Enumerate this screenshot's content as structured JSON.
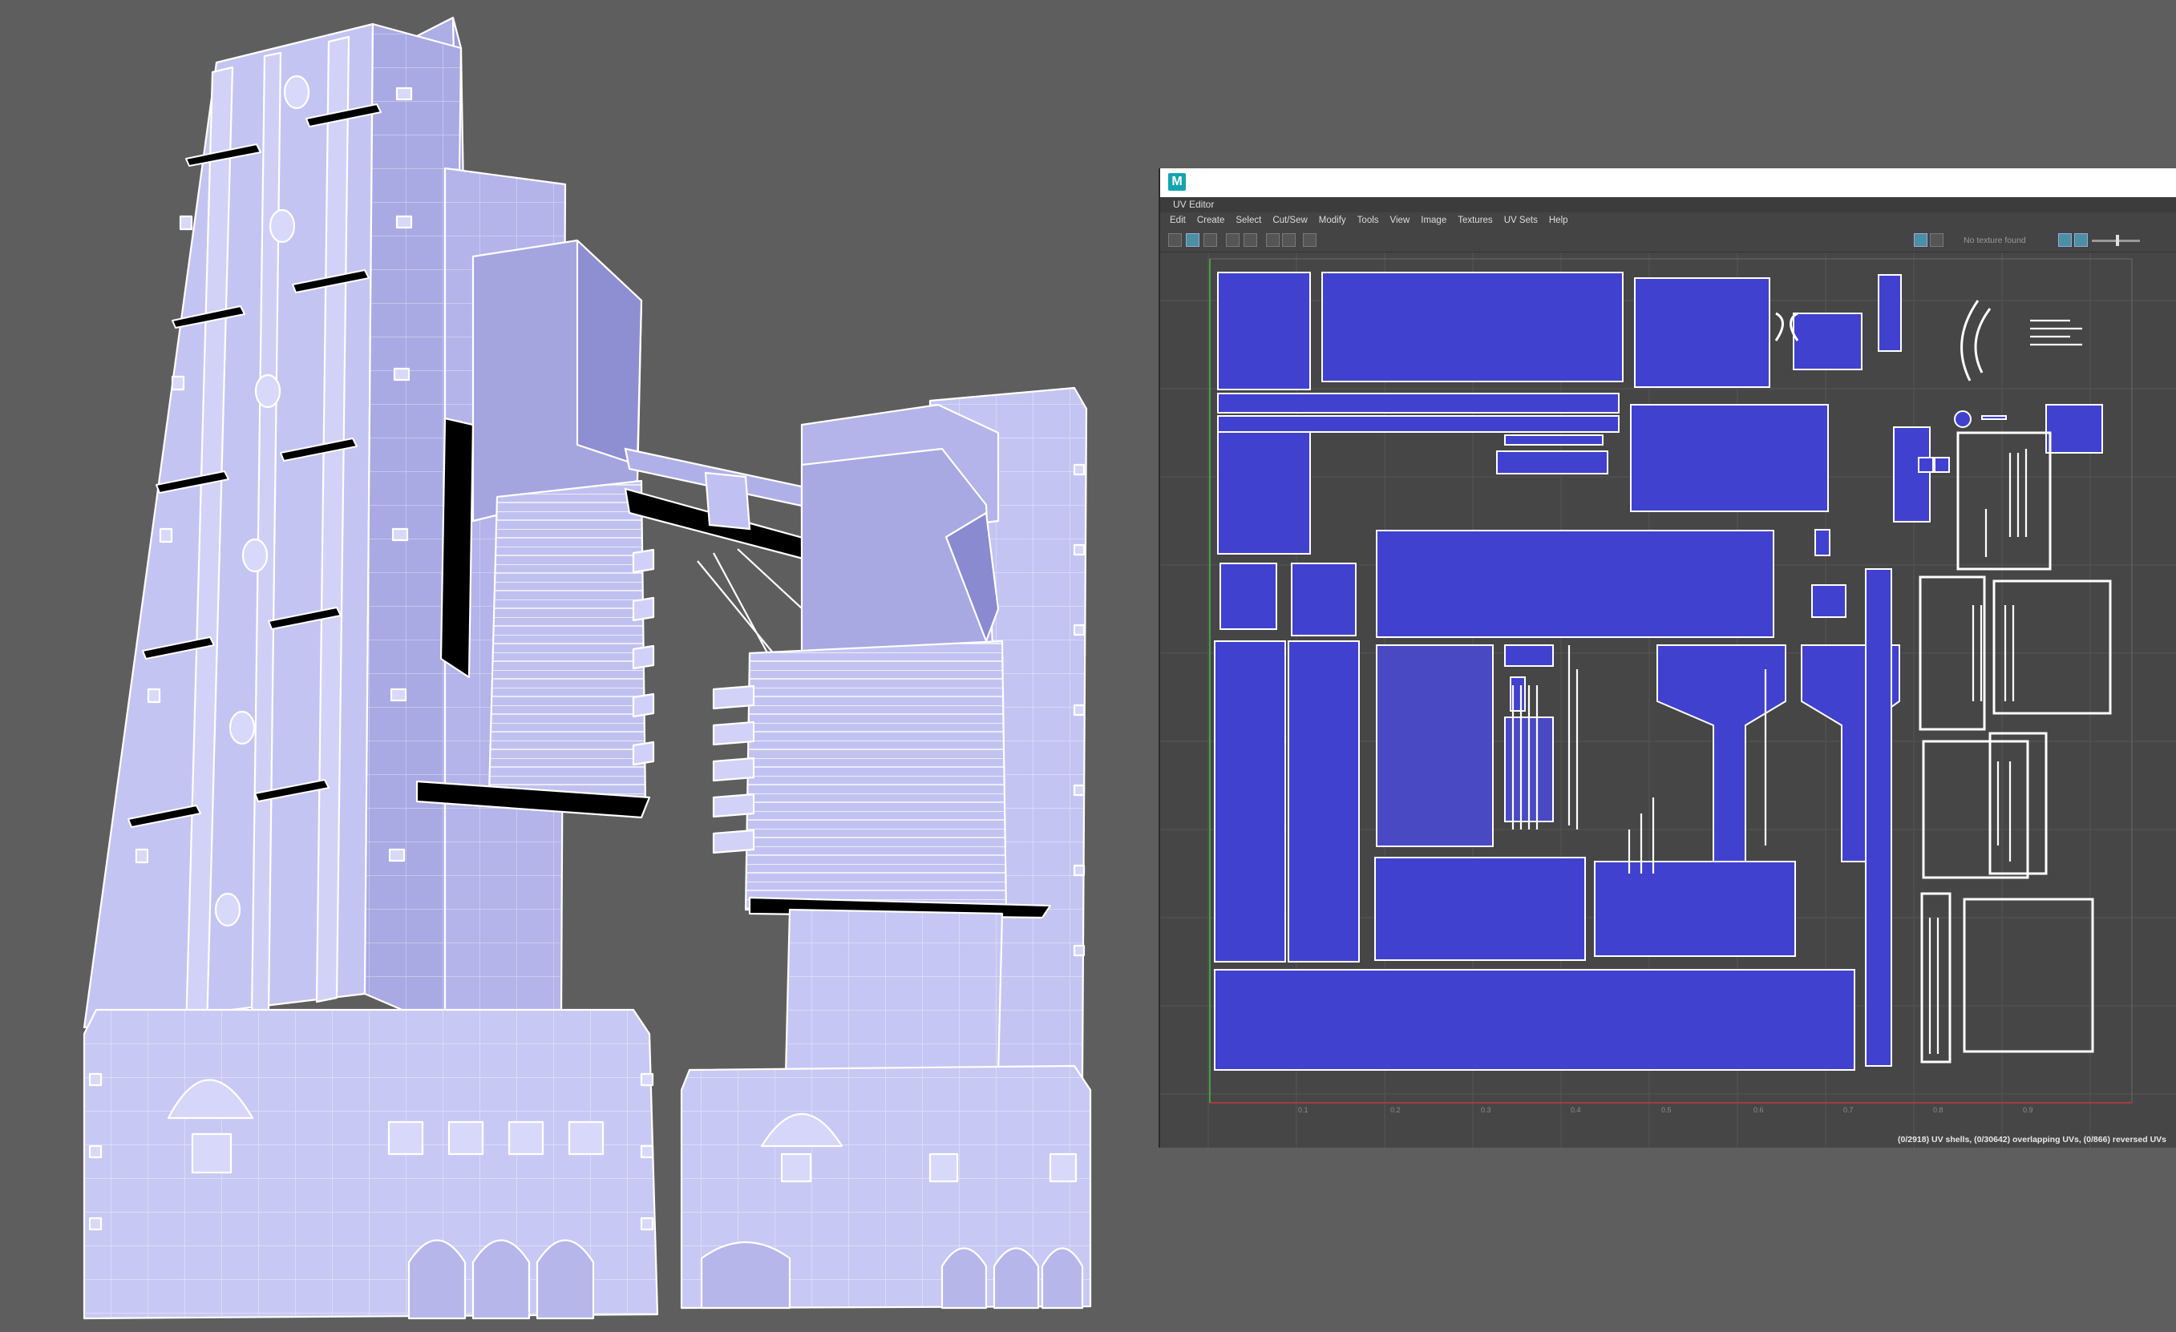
{
  "uv_editor": {
    "panel_title": "UV Editor",
    "menu": [
      "Edit",
      "Create",
      "Select",
      "Cut/Sew",
      "Modify",
      "Tools",
      "View",
      "Image",
      "Textures",
      "UV Sets",
      "Help"
    ],
    "texture_status": "No texture found",
    "axis_ticks": [
      "0.1",
      "0.2",
      "0.3",
      "0.4",
      "0.5",
      "0.6",
      "0.7",
      "0.8",
      "0.9"
    ],
    "status": "(0/2918) UV shells, (0/30642) overlapping UVs, (0/866) reversed UVs"
  },
  "colors": {
    "background": "#5e5e5e",
    "mesh_fill": "#bcbcf0",
    "mesh_wire": "#ffffff",
    "uv_shell": "#3f3fd0",
    "uv_wire": "#ffffff",
    "uv_grid": "#4a4a4a",
    "app_accent": "#12a4b0"
  },
  "icons": {
    "app": "maya-logo-icon",
    "texture_toggle": "image-icon",
    "checker": "checker-icon"
  }
}
